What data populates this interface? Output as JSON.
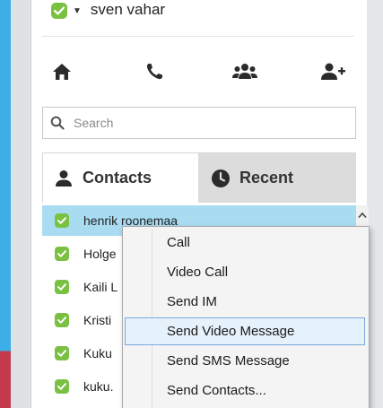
{
  "user": {
    "name": "sven vahar",
    "status_color": "#7ac143"
  },
  "toolbar": {
    "home_icon": "home-icon",
    "call_icon": "phone-icon",
    "group_icon": "group-icon",
    "add_contact_icon": "add-contact-icon"
  },
  "search": {
    "placeholder": "Search",
    "value": ""
  },
  "tabs": [
    {
      "label": "Contacts",
      "icon": "person-icon",
      "active": true
    },
    {
      "label": "Recent",
      "icon": "clock-icon",
      "active": false
    }
  ],
  "contacts": [
    {
      "name": "henrik roonemaa",
      "selected": true
    },
    {
      "name": "Holge"
    },
    {
      "name": "Kaili L"
    },
    {
      "name": "Kristi"
    },
    {
      "name": "Kuku"
    },
    {
      "name": "kuku."
    }
  ],
  "context_menu": {
    "items": [
      {
        "label": "Call"
      },
      {
        "label": "Video Call"
      },
      {
        "label": "Send IM"
      },
      {
        "label": "Send Video Message",
        "highlighted": true
      },
      {
        "label": "Send SMS Message"
      },
      {
        "label": "Send Contacts..."
      }
    ]
  },
  "colors": {
    "accent_blue": "#3eaee6",
    "selected_row": "#a9dcf1",
    "online_green": "#7ac143",
    "menu_highlight": "#e5f1fb"
  }
}
